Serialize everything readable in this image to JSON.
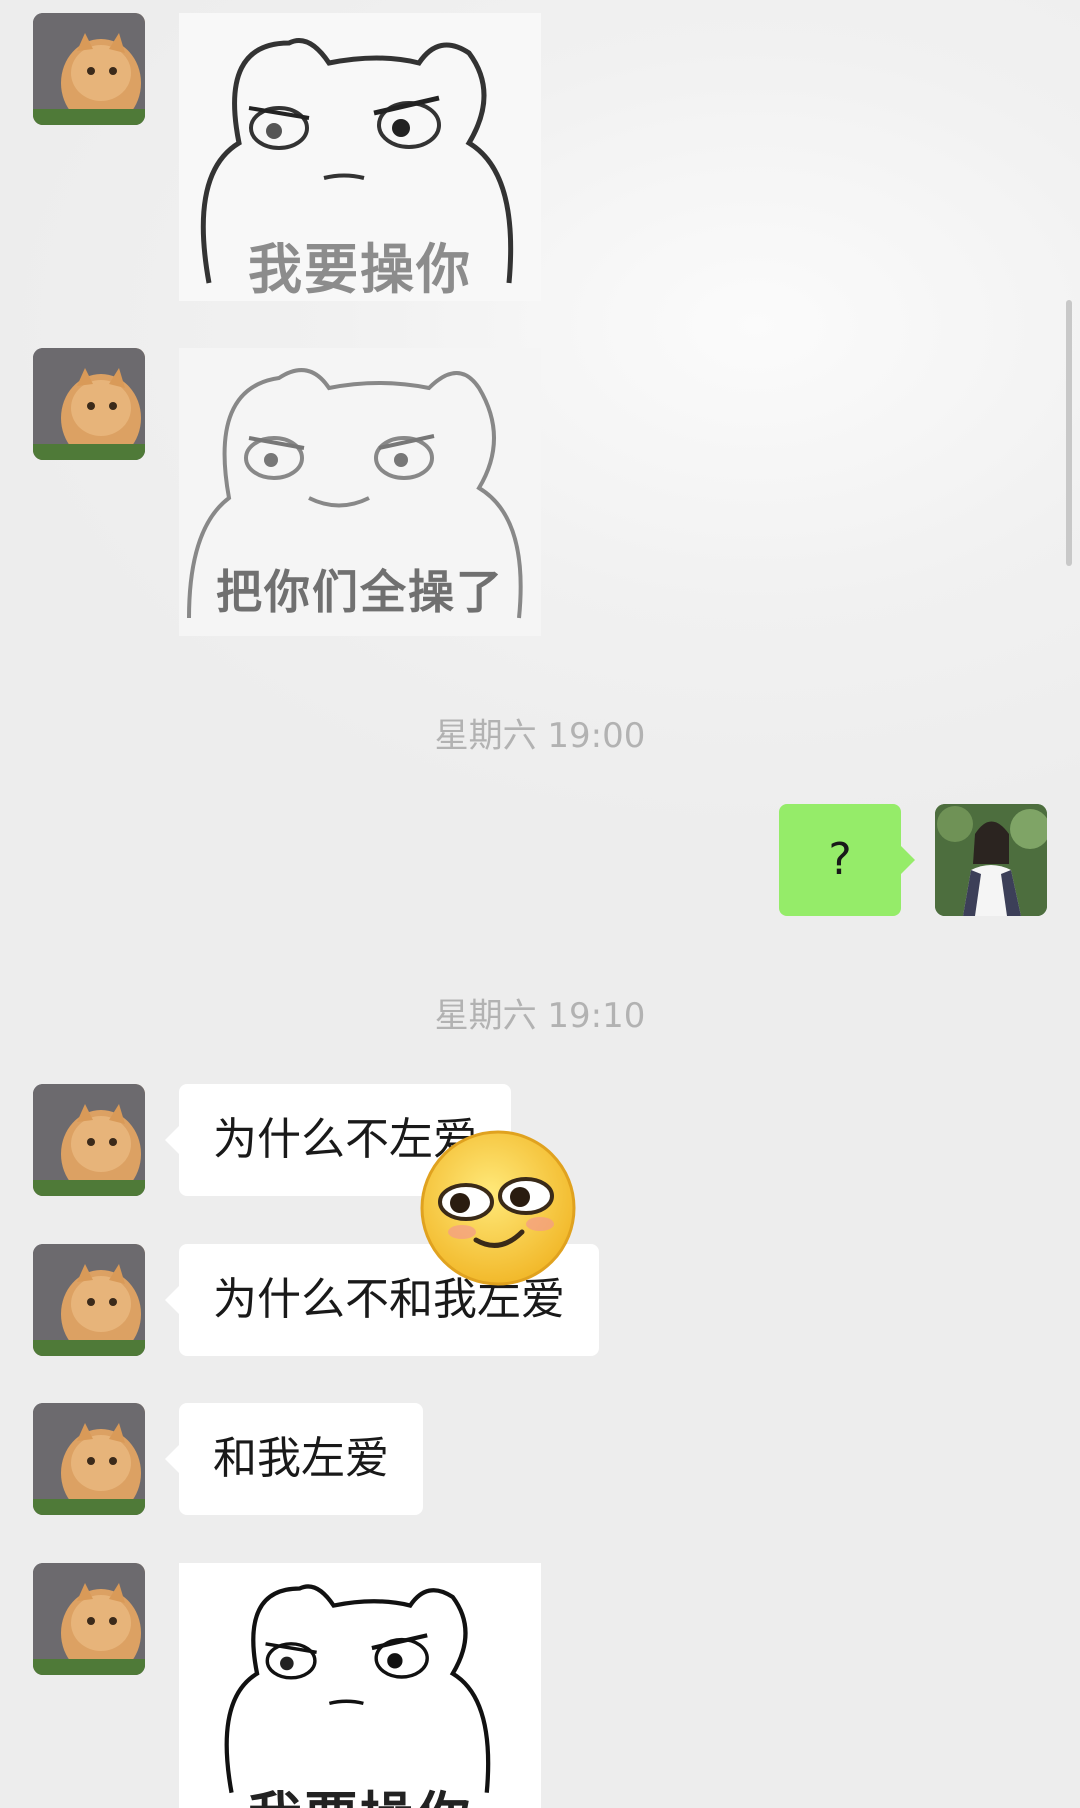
{
  "messages": [
    {
      "type": "sticker",
      "side": "in",
      "caption": "我要操你"
    },
    {
      "type": "sticker",
      "side": "in",
      "caption": "把你们全操了"
    },
    {
      "type": "timestamp",
      "text": "星期六 19:00"
    },
    {
      "type": "text",
      "side": "out",
      "text": "?"
    },
    {
      "type": "timestamp",
      "text": "星期六 19:10"
    },
    {
      "type": "text",
      "side": "in",
      "text": "为什么不左爱"
    },
    {
      "type": "text",
      "side": "in",
      "text": "为什么不和我左爱"
    },
    {
      "type": "text",
      "side": "in",
      "text": "和我左爱"
    },
    {
      "type": "sticker",
      "side": "in",
      "caption": "我要操你"
    }
  ],
  "colors": {
    "outgoing_bubble": "#95ec69",
    "incoming_bubble": "#ffffff",
    "timestamp": "#b2b2b2"
  },
  "icons": {
    "overlay_emoji": "smirk-emoji-icon"
  }
}
